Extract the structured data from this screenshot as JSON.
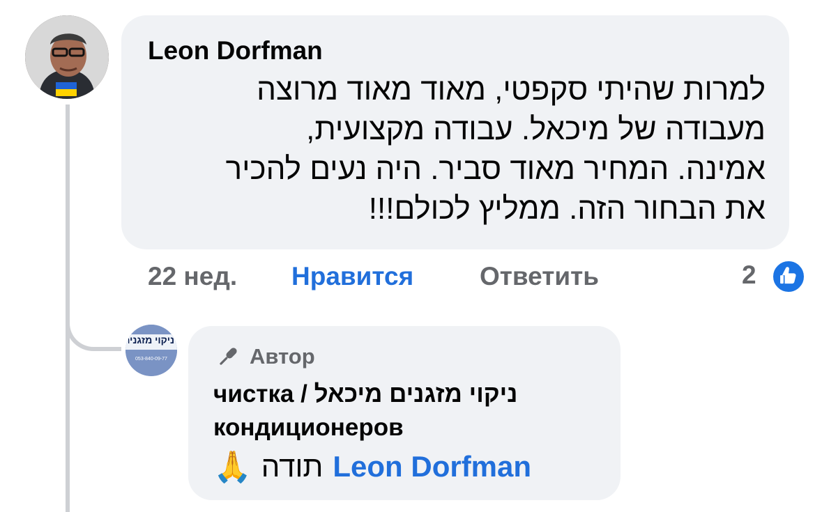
{
  "comment": {
    "author": "Leon Dorfman",
    "text_lines": [
      "למרות שהיתי סקפטי, מאוד מאוד מרוצה",
      "מעבודה של מיכאל. עבודה מקצועית,",
      "אמינה. המחיר מאוד סביר. היה נעים להכיר",
      "את הבחור הזה. ממליץ לכולם!!!"
    ],
    "time": "22 нед.",
    "like_label": "Нравится",
    "reply_label": "Ответить",
    "reaction_count": "2",
    "reaction_icon": "thumbs-up-icon"
  },
  "reply": {
    "badge_icon": "microphone-icon",
    "badge_label": "Автор",
    "author_line1": "ניקוי מזגנים מיכאל / чистка",
    "author_line2": "кондиционеров",
    "mention": "Leon Dorfman",
    "text": "תודה",
    "emoji": "🙏",
    "avatar_title": "ניקוי מזגנים",
    "avatar_phone": "053-840-09-77"
  },
  "colors": {
    "bubble": "#f0f2f5",
    "accent": "#216fdb",
    "meta": "#65676b",
    "thread": "#ced0d4"
  }
}
